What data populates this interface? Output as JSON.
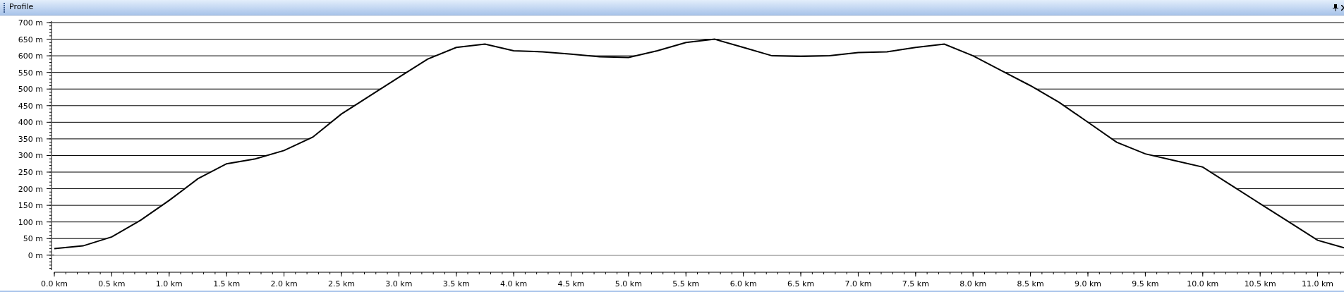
{
  "window": {
    "title": "Profile"
  },
  "chart_data": {
    "type": "area",
    "grid": true,
    "xlim": [
      0,
      11.23
    ],
    "ylim": [
      -45,
      700
    ],
    "xticks": [
      {
        "value": 0,
        "label": "0.0 km"
      },
      {
        "value": 0.5,
        "label": "0.5 km"
      },
      {
        "value": 1,
        "label": "1.0 km"
      },
      {
        "value": 1.5,
        "label": "1.5 km"
      },
      {
        "value": 2,
        "label": "2.0 km"
      },
      {
        "value": 2.5,
        "label": "2.5 km"
      },
      {
        "value": 3,
        "label": "3.0 km"
      },
      {
        "value": 3.5,
        "label": "3.5 km"
      },
      {
        "value": 4,
        "label": "4.0 km"
      },
      {
        "value": 4.5,
        "label": "4.5 km"
      },
      {
        "value": 5,
        "label": "5.0 km"
      },
      {
        "value": 5.5,
        "label": "5.5 km"
      },
      {
        "value": 6,
        "label": "6.0 km"
      },
      {
        "value": 6.5,
        "label": "6.5 km"
      },
      {
        "value": 7,
        "label": "7.0 km"
      },
      {
        "value": 7.5,
        "label": "7.5 km"
      },
      {
        "value": 8,
        "label": "8.0 km"
      },
      {
        "value": 8.5,
        "label": "8.5 km"
      },
      {
        "value": 9,
        "label": "9.0 km"
      },
      {
        "value": 9.5,
        "label": "9.5 km"
      },
      {
        "value": 10,
        "label": "10.0 km"
      },
      {
        "value": 10.5,
        "label": "10.5 km"
      },
      {
        "value": 11,
        "label": "11.0 km"
      }
    ],
    "yticks": [
      {
        "value": 0,
        "label": "0 m"
      },
      {
        "value": 50,
        "label": "50 m"
      },
      {
        "value": 100,
        "label": "100 m"
      },
      {
        "value": 150,
        "label": "150 m"
      },
      {
        "value": 200,
        "label": "200 m"
      },
      {
        "value": 250,
        "label": "250 m"
      },
      {
        "value": 300,
        "label": "300 m"
      },
      {
        "value": 350,
        "label": "350 m"
      },
      {
        "value": 400,
        "label": "400 m"
      },
      {
        "value": 450,
        "label": "450 m"
      },
      {
        "value": 500,
        "label": "500 m"
      },
      {
        "value": 550,
        "label": "550 m"
      },
      {
        "value": 600,
        "label": "600 m"
      },
      {
        "value": 650,
        "label": "650 m"
      },
      {
        "value": 700,
        "label": "700 m"
      }
    ],
    "x": [
      0,
      0.25,
      0.5,
      0.75,
      1,
      1.25,
      1.5,
      1.75,
      2,
      2.25,
      2.5,
      2.75,
      3,
      3.25,
      3.5,
      3.75,
      4,
      4.25,
      4.5,
      4.75,
      5,
      5.25,
      5.5,
      5.75,
      6,
      6.25,
      6.5,
      6.75,
      7,
      7.25,
      7.5,
      7.75,
      8,
      8.25,
      8.5,
      8.75,
      9,
      9.25,
      9.5,
      9.75,
      10,
      10.25,
      10.5,
      10.75,
      11,
      11.23
    ],
    "series": [
      {
        "color": "#000000",
        "values": [
          20,
          28,
          55,
          105,
          165,
          230,
          275,
          290,
          315,
          355,
          425,
          480,
          535,
          590,
          625,
          635,
          615,
          612,
          605,
          597,
          595,
          615,
          640,
          650,
          625,
          600,
          598,
          600,
          610,
          612,
          625,
          635,
          600,
          555,
          510,
          460,
          400,
          340,
          305,
          285,
          265,
          210,
          155,
          100,
          45,
          22
        ]
      }
    ]
  }
}
